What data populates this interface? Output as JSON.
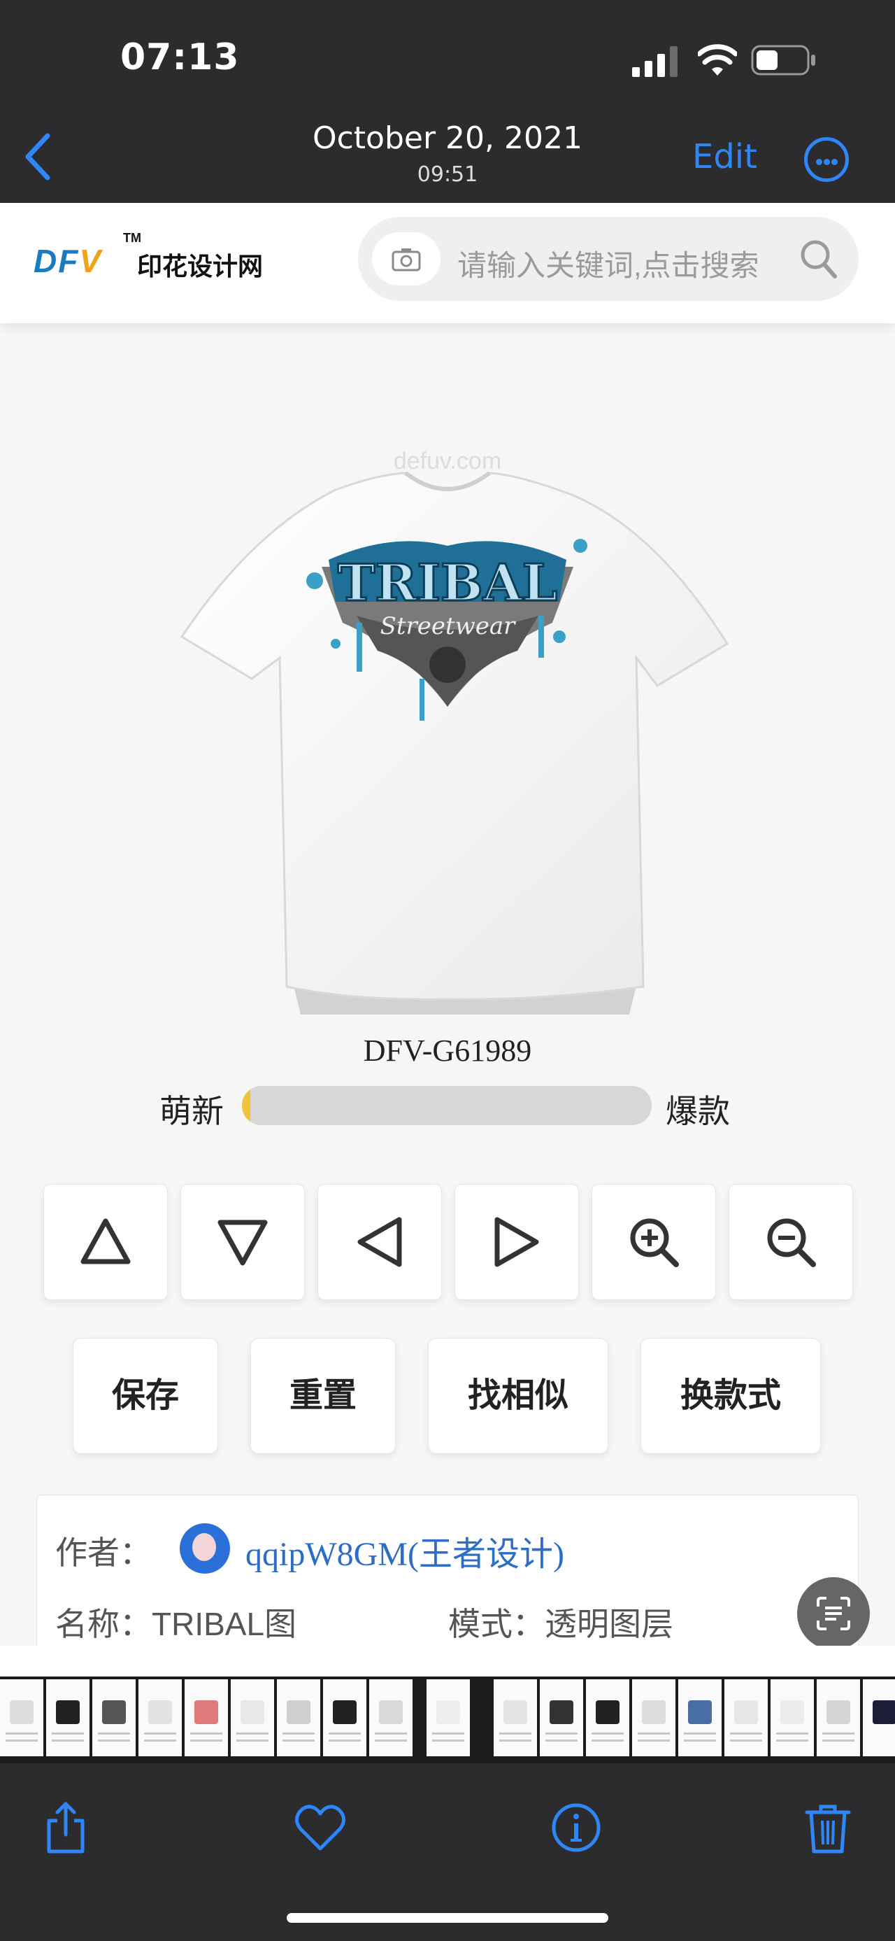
{
  "status_bar": {
    "time": "07:13"
  },
  "photo_header": {
    "date": "October 20, 2021",
    "time": "09:51",
    "edit_label": "Edit"
  },
  "site": {
    "logo_letters": "DF",
    "logo_accent": "V",
    "logo_tm": "TM",
    "logo_text": "印花设计网",
    "search_placeholder": "请输入关键词,点击搜索"
  },
  "product": {
    "watermark": "defuv.com",
    "print_title": "TRIBAL",
    "print_subtitle": "Streetwear",
    "sku": "DFV-G61989",
    "level_left": "萌新",
    "level_right": "爆款",
    "level_progress": 0.02
  },
  "controls": {
    "move_up": "triangle-up-icon",
    "move_down": "triangle-down-icon",
    "move_left": "triangle-left-icon",
    "move_right": "triangle-right-icon",
    "zoom_in": "zoom-in-icon",
    "zoom_out": "zoom-out-icon"
  },
  "actions": {
    "save": "保存",
    "reset": "重置",
    "find_similar": "找相似",
    "change_style": "换款式"
  },
  "info": {
    "author_label": "作者：",
    "author_name": "qqipW8GM(王者设计)",
    "name_label": "名称：TRIBAL图",
    "mode_label": "模式：透明图层"
  },
  "colors": {
    "ios_blue": "#2f86f7",
    "header_bg": "#2c2c2e",
    "link_blue": "#2c6ec5",
    "logo_blue": "#1b7bbf",
    "logo_orange": "#f1a316"
  }
}
